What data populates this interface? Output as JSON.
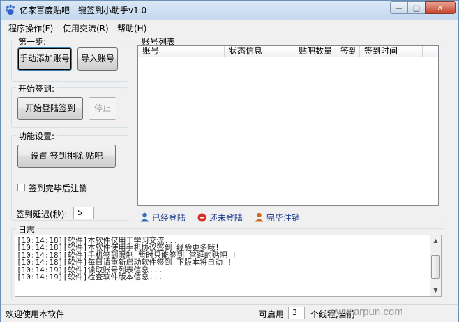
{
  "window": {
    "title": "亿家百度贴吧一键签到小助手v1.0"
  },
  "titlebar": {
    "min": "—",
    "max": "□",
    "close": "✕"
  },
  "menu": [
    "程序操作(F)",
    "使用交流(R)",
    "帮助(H)"
  ],
  "step1": {
    "title": "第一步:",
    "add_account": "手动添加账号",
    "import_account": "导入账号"
  },
  "signin": {
    "title": "开始签到:",
    "start": "开始登陆签到",
    "stop": "停止"
  },
  "settings": {
    "title": "功能设置:",
    "config_button": "设置 签到排除 贴吧",
    "logout_after": "签到完毕后注销",
    "logout_after_checked": false,
    "delay_label": "签到延迟(秒):",
    "delay_value": "5"
  },
  "accounts": {
    "title": "账号列表",
    "columns": [
      "账号",
      "状态信息",
      "贴吧数量",
      "签到",
      "签到时间"
    ],
    "rows": []
  },
  "status_legend": [
    {
      "label": "已经登陆",
      "color": "#3a6fb5"
    },
    {
      "label": "还未登陆",
      "color": "#d93025"
    },
    {
      "label": "完毕注销",
      "color": "#d2691e"
    }
  ],
  "log": {
    "title": "日志",
    "lines": [
      "[10:14:18][软件]本软件仅用于学习交流...",
      "[10:14:18][软件]本软件使用手机协议签到 经验更多哦!",
      "[10:14:18][软件]手机签到限制 暂时只能签到 常逛的贴吧 !",
      "[10:14:18][软件]每日请重新启动软件签到 下版本将自动 !",
      "[10:14:19][软件]读取账号列表信息...",
      "[10:14:19][软件]检查软件版本信息..."
    ]
  },
  "statusbar": {
    "welcome": "欢迎使用本软件",
    "threads_label": "可启用",
    "threads_value": "3",
    "threads_suffix": "个线程,当前"
  },
  "watermark": "www.arpun.com"
}
